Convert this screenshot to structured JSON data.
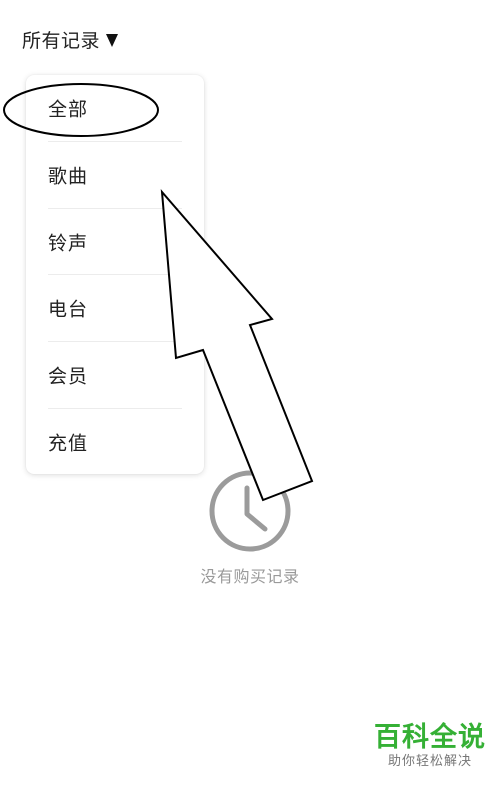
{
  "header": {
    "filter_label": "所有记录",
    "caret_icon": "caret-down-icon"
  },
  "menu": {
    "items": [
      {
        "label": "全部",
        "highlighted": true
      },
      {
        "label": "歌曲"
      },
      {
        "label": "铃声"
      },
      {
        "label": "电台"
      },
      {
        "label": "会员"
      },
      {
        "label": "充值"
      }
    ]
  },
  "empty_state": {
    "icon": "clock-icon",
    "message": "没有购买记录"
  },
  "watermark": {
    "title": "百科全说",
    "subtitle": "助你轻松解决"
  },
  "colors": {
    "text_primary": "#222222",
    "text_muted": "#9a9a9a",
    "icon_gray": "#9b9b9b",
    "watermark_green": "#35b035",
    "annotation_black": "#000000"
  }
}
